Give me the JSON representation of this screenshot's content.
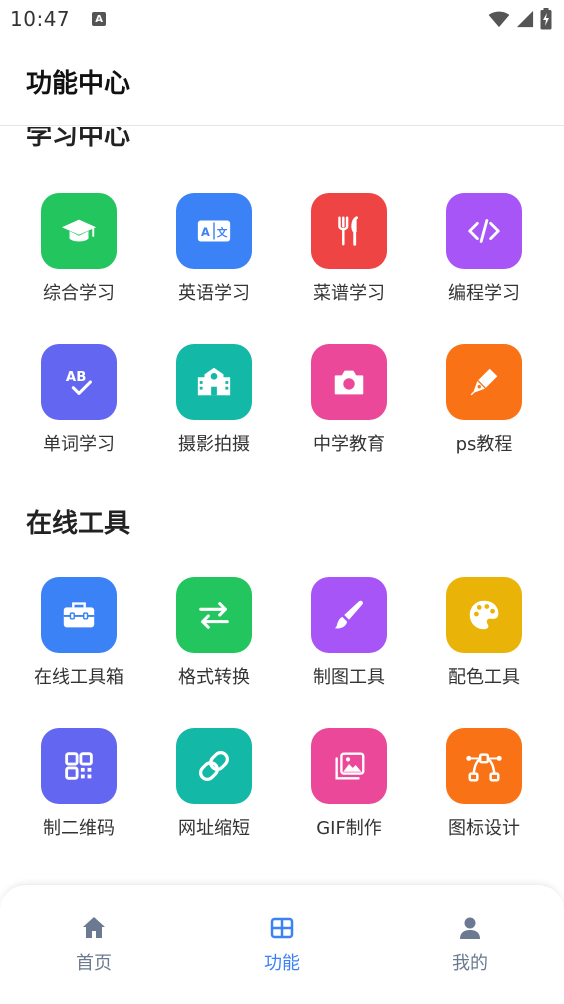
{
  "status_bar": {
    "time": "10:47",
    "notif_icon": "A"
  },
  "app_bar": {
    "title": "功能中心"
  },
  "sections": [
    {
      "title": "学习中心",
      "items": [
        {
          "label": "综合学习",
          "icon": "graduation-cap-icon",
          "color": "#22c55e"
        },
        {
          "label": "英语学习",
          "icon": "translate-icon",
          "color": "#3b82f6"
        },
        {
          "label": "菜谱学习",
          "icon": "utensils-icon",
          "color": "#ef4444"
        },
        {
          "label": "编程学习",
          "icon": "code-icon",
          "color": "#a855f7"
        },
        {
          "label": "单词学习",
          "icon": "spell-check-icon",
          "color": "#6366f1"
        },
        {
          "label": "摄影拍摄",
          "icon": "school-icon",
          "color": "#14b8a6"
        },
        {
          "label": "中学教育",
          "icon": "camera-icon",
          "color": "#ec4899"
        },
        {
          "label": "ps教程",
          "icon": "pen-nib-icon",
          "color": "#f97316"
        }
      ]
    },
    {
      "title": "在线工具",
      "items": [
        {
          "label": "在线工具箱",
          "icon": "toolbox-icon",
          "color": "#3b82f6"
        },
        {
          "label": "格式转换",
          "icon": "swap-arrows-icon",
          "color": "#22c55e"
        },
        {
          "label": "制图工具",
          "icon": "paintbrush-icon",
          "color": "#a855f7"
        },
        {
          "label": "配色工具",
          "icon": "palette-icon",
          "color": "#eab308"
        },
        {
          "label": "制二维码",
          "icon": "qrcode-icon",
          "color": "#6366f1"
        },
        {
          "label": "网址缩短",
          "icon": "link-icon",
          "color": "#14b8a6"
        },
        {
          "label": "GIF制作",
          "icon": "photo-stack-icon",
          "color": "#ec4899"
        },
        {
          "label": "图标设计",
          "icon": "bezier-curve-icon",
          "color": "#f97316"
        }
      ]
    }
  ],
  "tabbar": {
    "items": [
      {
        "label": "首页",
        "icon": "home-icon",
        "color": "#6b7a90"
      },
      {
        "label": "功能",
        "icon": "grid-icon",
        "color": "#3b82f6"
      },
      {
        "label": "我的",
        "icon": "user-icon",
        "color": "#6b7a90"
      }
    ],
    "active_index": 1
  }
}
